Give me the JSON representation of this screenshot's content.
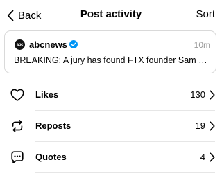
{
  "header": {
    "back_label": "Back",
    "title": "Post activity",
    "sort_label": "Sort"
  },
  "post": {
    "avatar_text": "abc",
    "username": "abcnews",
    "verified": true,
    "time": "10m",
    "snippet": "BREAKING: A jury has found FTX founder Sam Bankman-Fried guilty"
  },
  "activity": [
    {
      "icon": "heart-icon",
      "label": "Likes",
      "count": "130"
    },
    {
      "icon": "repost-icon",
      "label": "Reposts",
      "count": "19"
    },
    {
      "icon": "quote-icon",
      "label": "Quotes",
      "count": "4"
    }
  ],
  "colors": {
    "verified_blue": "#0095f6",
    "muted_text": "#999999",
    "border": "#d9d9d9"
  }
}
